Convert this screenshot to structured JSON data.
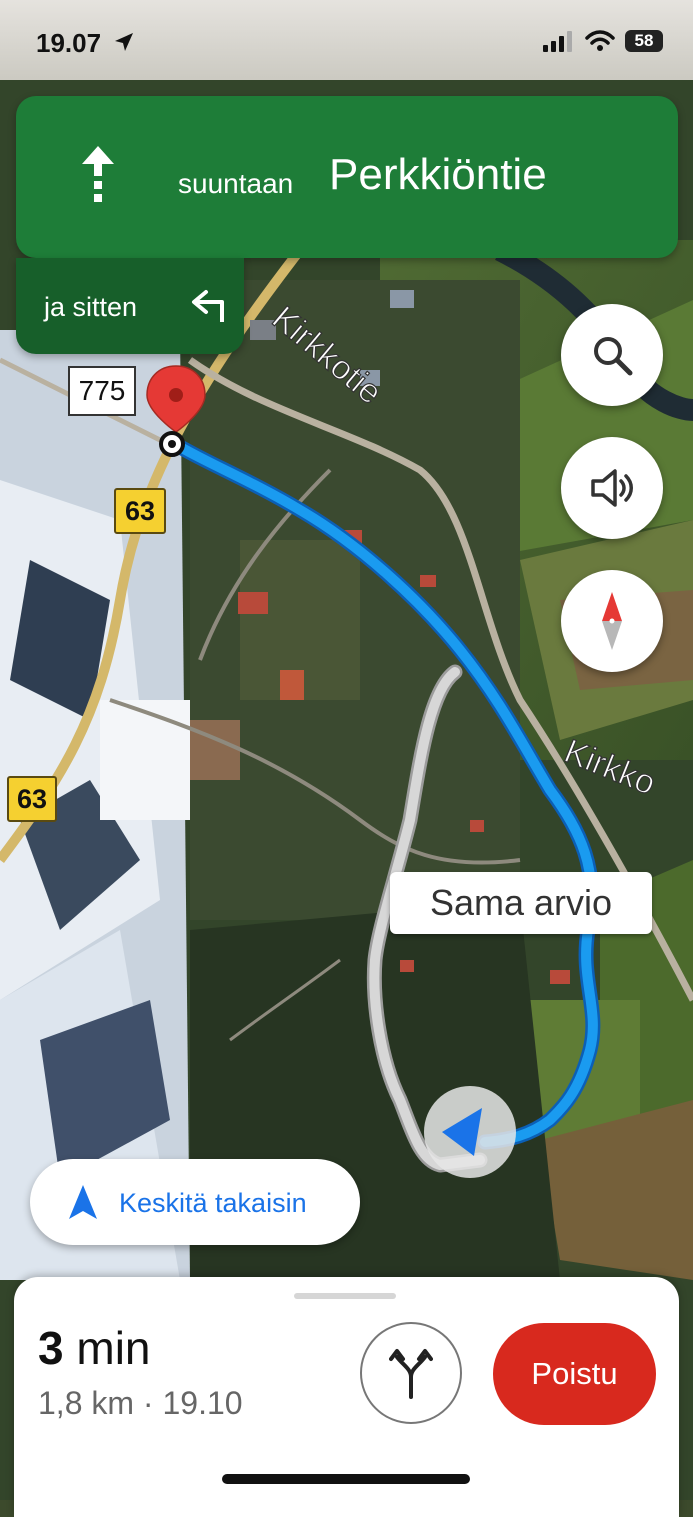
{
  "status": {
    "time": "19.07",
    "battery": "58"
  },
  "nav": {
    "prefix": "suuntaan",
    "street": "Perkkiöntie",
    "then": "ja sitten"
  },
  "map": {
    "roads": {
      "r775": "775",
      "r63a": "63",
      "r63b": "63"
    },
    "street_labels": {
      "kirkkotie": "Kirkkotie",
      "kirkko": "Kirkko"
    },
    "alt_route_label": "Sama arvio",
    "route_color": "#1a9bf0"
  },
  "controls": {
    "recenter": "Keskitä takaisin"
  },
  "trip": {
    "minutes": "3",
    "unit": "min",
    "details": "1,8 km · 19.10",
    "exit": "Poistu"
  }
}
